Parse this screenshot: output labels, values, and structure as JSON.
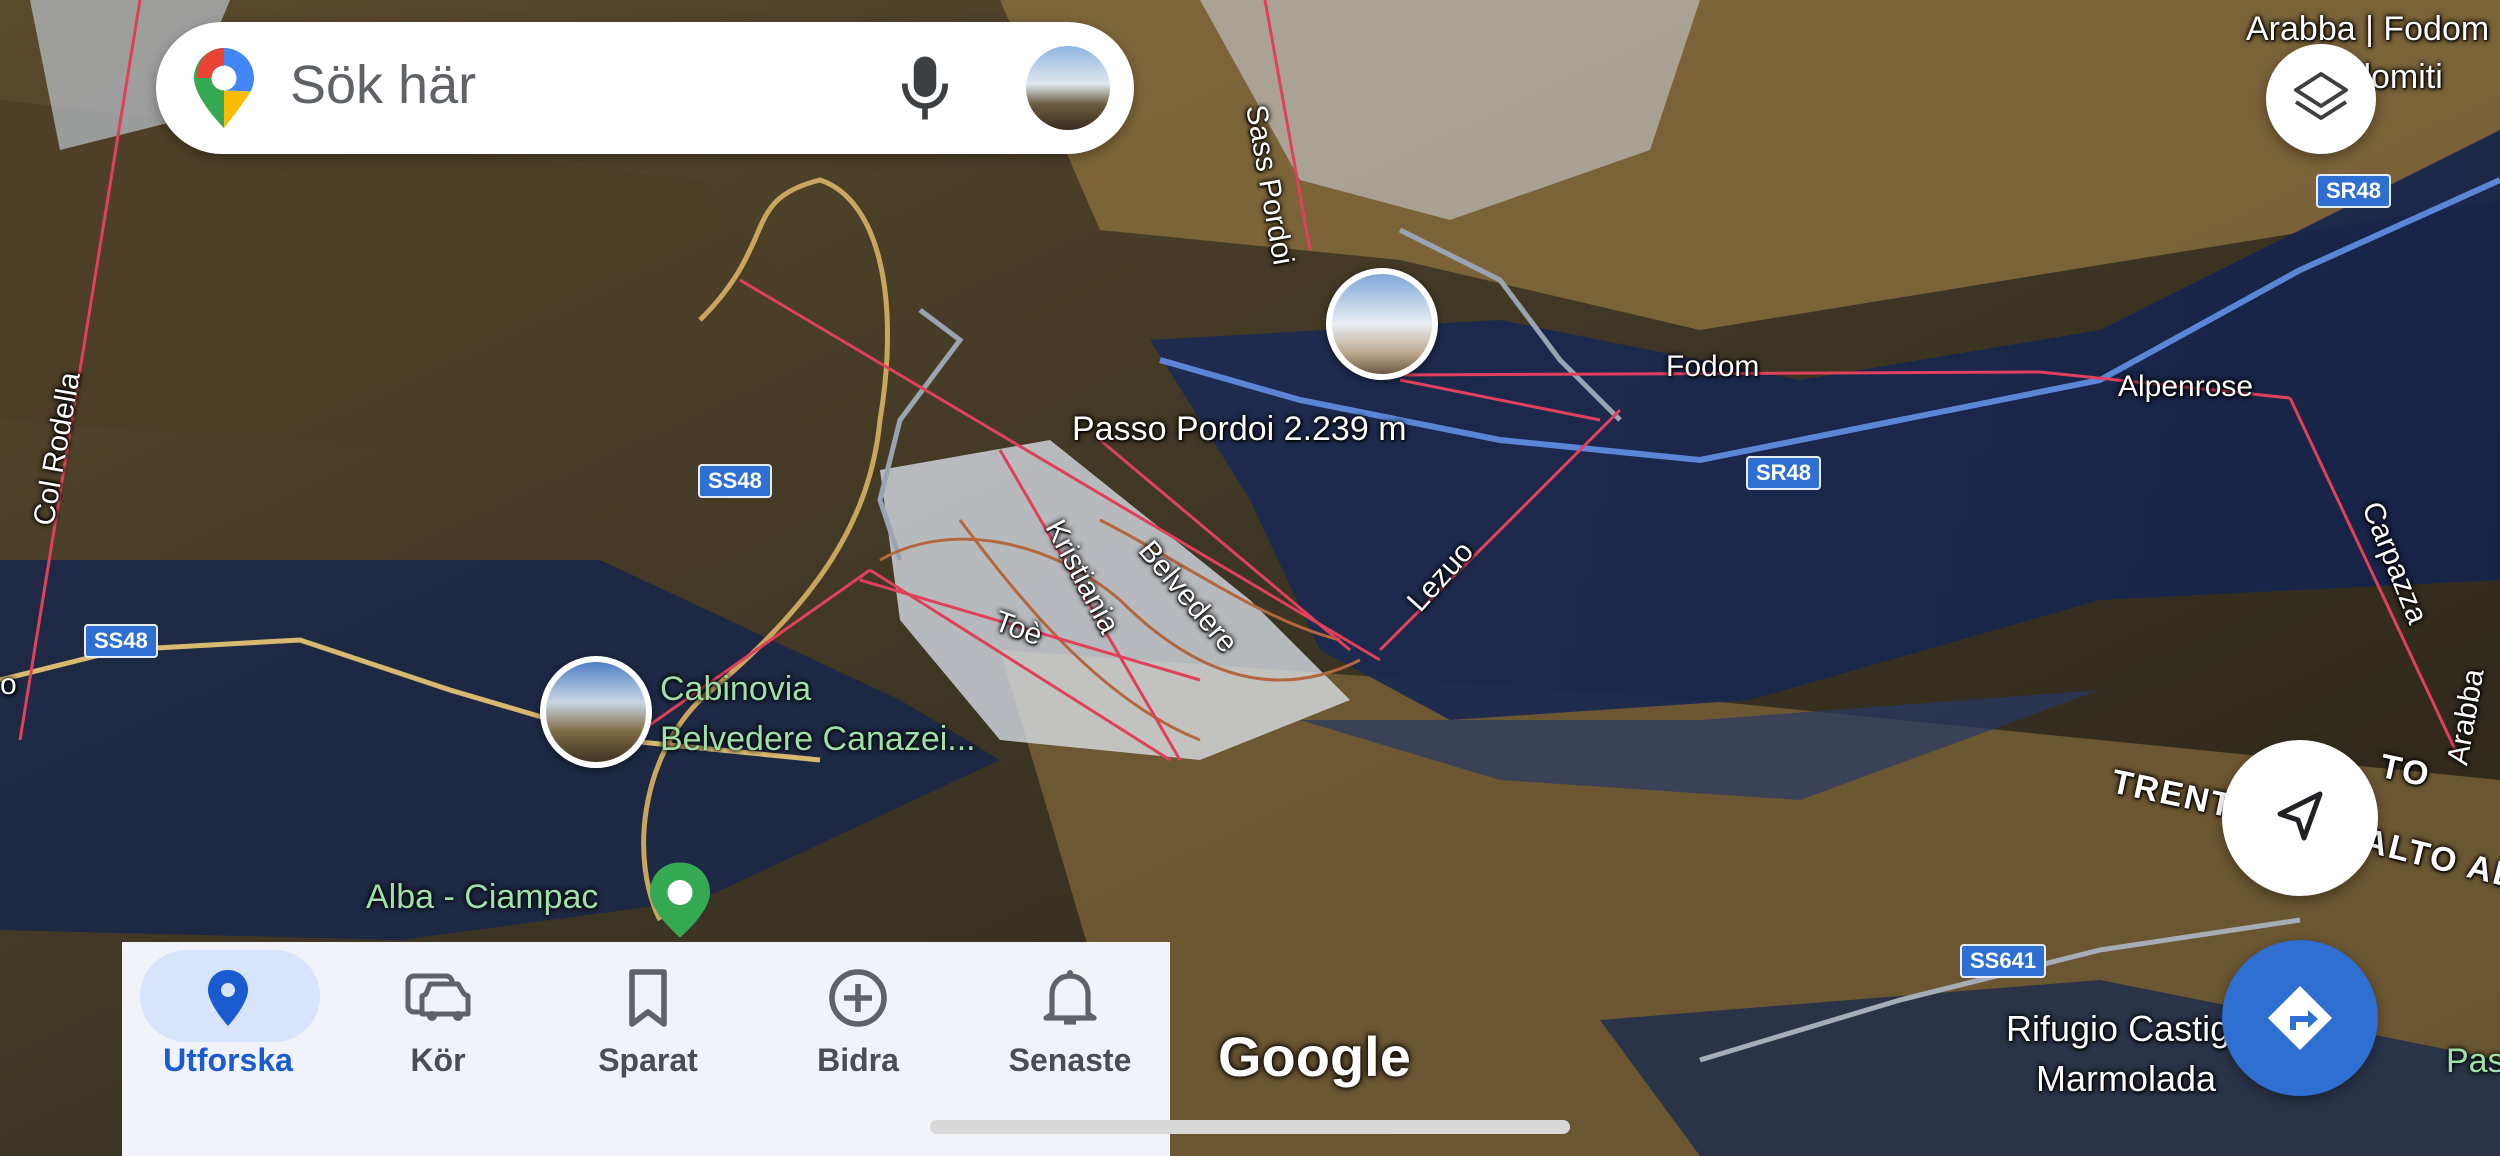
{
  "search": {
    "placeholder": "Sök här"
  },
  "map_labels": {
    "passo_pordoi": "Passo Pordoi 2.239 m",
    "fodom": "Fodom",
    "alpenrose": "Alpenrose",
    "sass_pordoi": "Sass Pordoi",
    "col_rodella": "Col Rodella",
    "kristiania": "Kristiania",
    "belvedere": "Belvedere",
    "toe": "Toè",
    "lezuo": "Lezuo",
    "carpazza": "Carpazza",
    "arabba_top": "Arabba | Fodom",
    "dolomiti_top": "Dolomiti",
    "trentino": "TRENTINO",
    "alto_adige": "ALTO ADIGE",
    "rifugio_line1": "Rifugio Castiglioni",
    "rifugio_line2": "Marmolada",
    "pas_edge": "Pas",
    "arabba_edge": "Arabba",
    "o_edge": "o",
    "to_partial": "TO"
  },
  "road_shields": {
    "sr48_top": "SR48",
    "ss48_mid": "SS48",
    "sr48_mid": "SR48",
    "ss48_left": "SS48",
    "ss641": "SS641"
  },
  "places": {
    "cabinovia_line1": "Cabinovia",
    "cabinovia_line2": "Belvedere Canazei...",
    "alba": "Alba - Ciampac"
  },
  "nav": {
    "items": [
      {
        "label": "Utforska",
        "icon": "place-pin-icon",
        "active": true
      },
      {
        "label": "Kör",
        "icon": "car-icon",
        "active": false
      },
      {
        "label": "Sparat",
        "icon": "bookmark-icon",
        "active": false
      },
      {
        "label": "Bidra",
        "icon": "add-circle-icon",
        "active": false
      },
      {
        "label": "Senaste",
        "icon": "bell-icon",
        "active": false
      }
    ]
  },
  "attribution": "Google",
  "colors": {
    "accent": "#2f6fd1",
    "active_pill": "#d8e4fb",
    "active_text": "#1a5bd0",
    "place_green": "#34a853",
    "lift_line": "#e0405a"
  }
}
